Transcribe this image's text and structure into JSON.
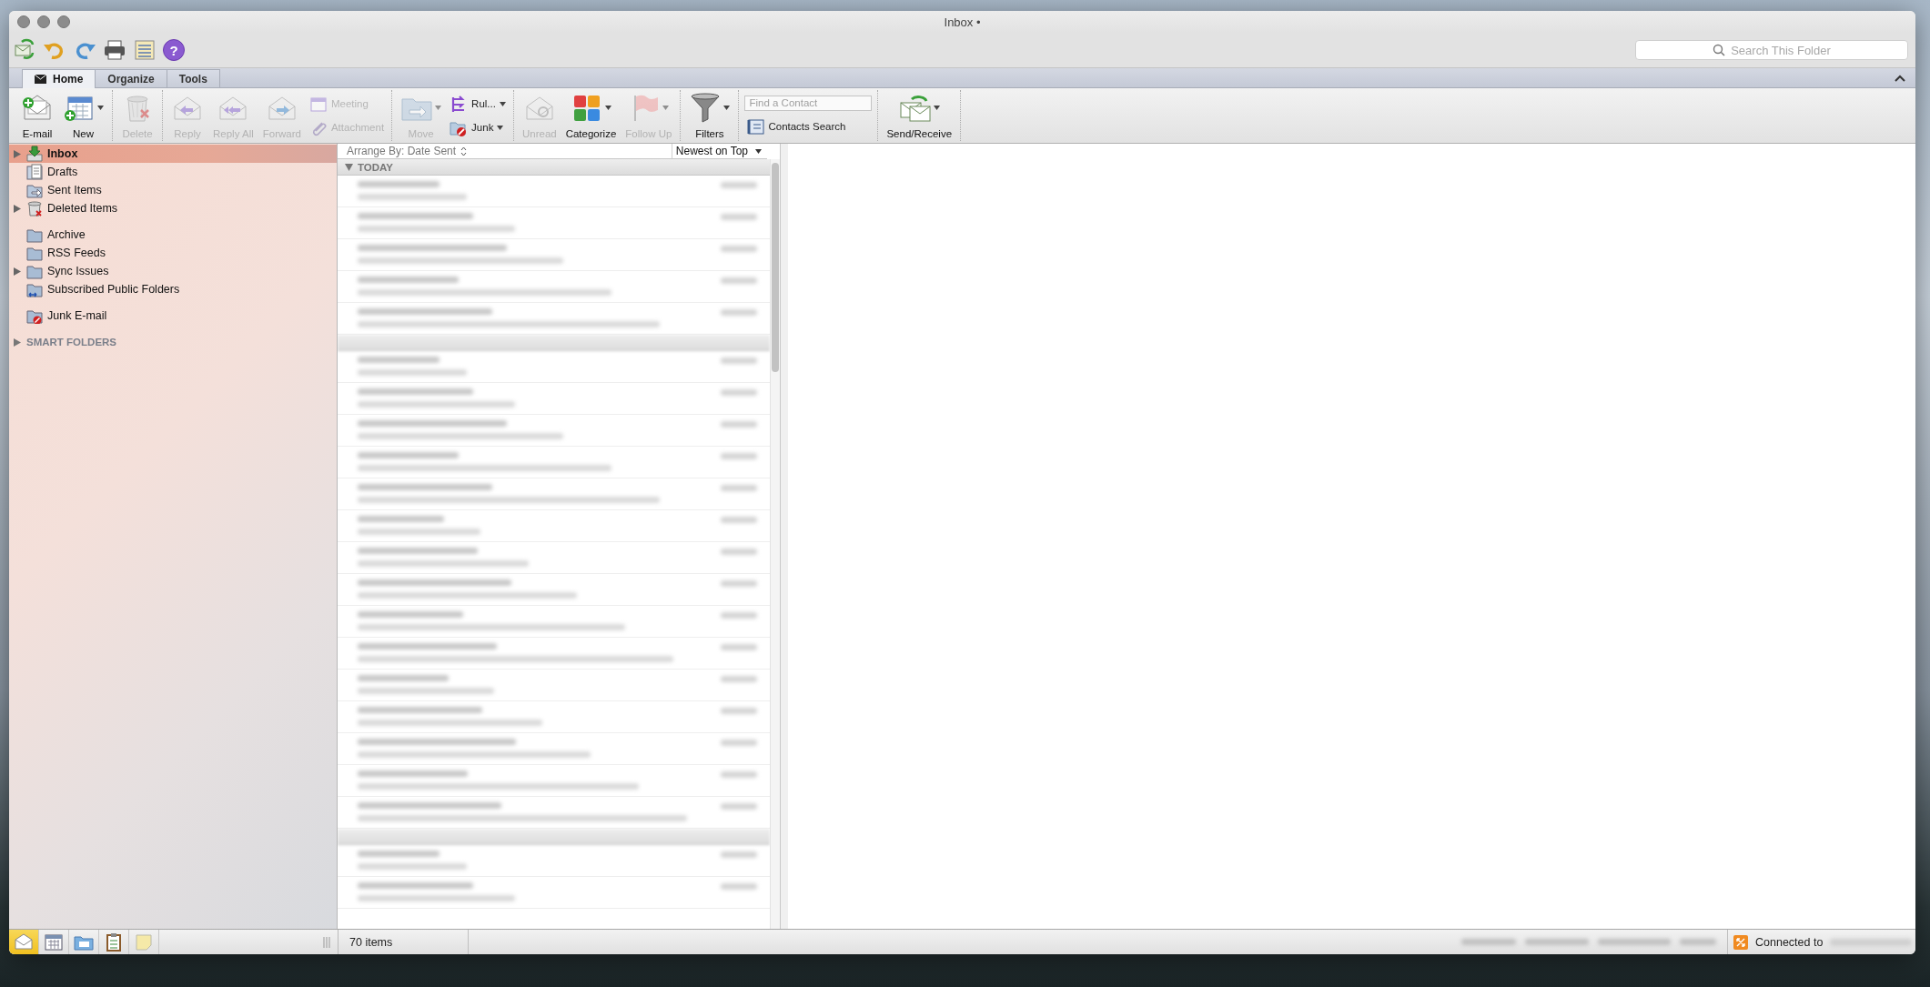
{
  "window": {
    "title": "Inbox •"
  },
  "quick_toolbar": {
    "help": "?"
  },
  "search": {
    "placeholder": "Search This Folder"
  },
  "tabs": [
    {
      "label": "Home",
      "selected": true
    },
    {
      "label": "Organize",
      "selected": false
    },
    {
      "label": "Tools",
      "selected": false
    }
  ],
  "ribbon": {
    "groups": [
      {
        "buttons": [
          {
            "label": "E-mail",
            "kind": "large",
            "disabled": false,
            "dropdown": false
          },
          {
            "label": "New",
            "kind": "large",
            "disabled": false,
            "dropdown": true
          }
        ]
      },
      {
        "buttons": [
          {
            "label": "Delete",
            "kind": "large",
            "disabled": true,
            "dropdown": false
          }
        ]
      },
      {
        "buttons": [
          {
            "label": "Reply",
            "kind": "large",
            "disabled": true,
            "dropdown": false
          },
          {
            "label": "Reply All",
            "kind": "large",
            "disabled": true,
            "dropdown": false
          },
          {
            "label": "Forward",
            "kind": "large",
            "disabled": true,
            "dropdown": false
          },
          {
            "label": "Meeting",
            "kind": "small",
            "disabled": true,
            "dropdown": false
          },
          {
            "label": "Attachment",
            "kind": "small",
            "disabled": true,
            "dropdown": false
          }
        ]
      },
      {
        "buttons": [
          {
            "label": "Move",
            "kind": "large",
            "disabled": true,
            "dropdown": true
          },
          {
            "label": "Rul...",
            "kind": "small",
            "disabled": false,
            "dropdown": true
          },
          {
            "label": "Junk",
            "kind": "small",
            "disabled": false,
            "dropdown": true
          }
        ]
      },
      {
        "buttons": [
          {
            "label": "Unread",
            "kind": "large",
            "disabled": true,
            "dropdown": false
          },
          {
            "label": "Categorize",
            "kind": "large",
            "disabled": false,
            "dropdown": true
          },
          {
            "label": "Follow Up",
            "kind": "large",
            "disabled": true,
            "dropdown": true
          }
        ]
      },
      {
        "buttons": [
          {
            "label": "Filters",
            "kind": "large",
            "disabled": false,
            "dropdown": true
          }
        ]
      },
      {
        "buttons": [
          {
            "placeholder": "Find a Contact",
            "kind": "field"
          },
          {
            "label": "Contacts Search",
            "kind": "small",
            "disabled": false,
            "dropdown": false
          }
        ]
      },
      {
        "buttons": [
          {
            "label": "Send/Receive",
            "kind": "large",
            "disabled": false,
            "dropdown": true
          }
        ]
      }
    ]
  },
  "sidebar": {
    "groups": [
      [
        {
          "label": "Inbox",
          "selected": true,
          "expanded": false
        },
        {
          "label": "Drafts",
          "selected": false
        },
        {
          "label": "Sent Items",
          "selected": false
        },
        {
          "label": "Deleted Items",
          "selected": false,
          "expanded": false
        }
      ],
      [
        {
          "label": "Archive",
          "selected": false
        },
        {
          "label": "RSS Feeds",
          "selected": false
        },
        {
          "label": "Sync Issues",
          "selected": false,
          "expanded": false
        },
        {
          "label": "Subscribed Public Folders",
          "selected": false
        }
      ],
      [
        {
          "label": "Junk E-mail",
          "selected": false
        }
      ]
    ],
    "smart_folders": {
      "label": "SMART FOLDERS",
      "expanded": false
    }
  },
  "message_list": {
    "arrange": "Arrange By: Date Sent",
    "sort": "Newest on Top",
    "sections": [
      {
        "label": "TODAY",
        "expanded": true
      }
    ]
  },
  "nav_buttons": [
    {
      "selected": true
    },
    {
      "selected": false
    },
    {
      "selected": false
    },
    {
      "selected": false
    },
    {
      "selected": false
    }
  ],
  "status_bar": {
    "count": "70 items",
    "connection": "Connected to"
  }
}
